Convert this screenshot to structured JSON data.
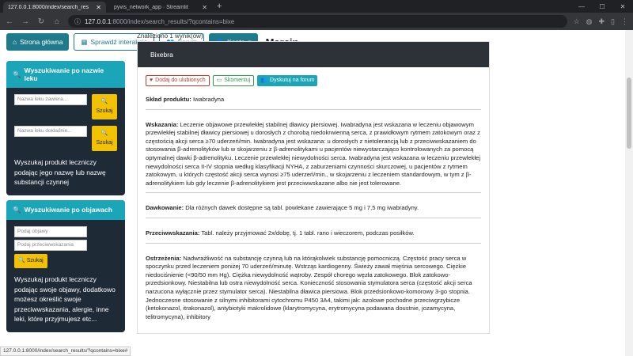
{
  "browser": {
    "tabs": [
      {
        "title": "127.0.0.1:8000/index/search_res",
        "active": true
      },
      {
        "title": "pyvis_network_app · Streamlit",
        "active": false
      }
    ],
    "address_host": "127.0.0.1",
    "address_path": ":8000/index/search_results/?qcontains=bixe",
    "status_url": "127.0.0.1:8000/index/search_results/?qcontains=bixe#"
  },
  "nav": {
    "home": "Strona główna",
    "check": "Sprawdź interakcje",
    "forum": "Forum",
    "account": "Konto",
    "user": "Marcin"
  },
  "sidebar": {
    "by_name": {
      "title": "Wyszukiwanie po nazwie leku",
      "input1_placeholder": "Nazwa leku zawiera...",
      "input2_placeholder": "Nazwa leku dokładnie...",
      "search_label": "Szukaj",
      "description": "Wyszukaj produkt leczniczy podając jego nazwę lub nazwę substancji czynnej"
    },
    "by_symptoms": {
      "title": "Wyszukiwanie po objawach",
      "input1_placeholder": "Podaj objawy",
      "input2_placeholder": "Podaj przeciwwskazania",
      "search_label": "Szukaj",
      "description": "Wyszukaj produkt leczniczy podając swoje objawy, dodatkowo możesz określić swoje przeciwwskazania, alergie, inne leki, które przyjmujesz etc..."
    }
  },
  "results": {
    "found_text": "Znaleziono 1 wynik(ów)",
    "product_name": "Bixebra",
    "actions": {
      "favorite": "Dodaj do ulubionych",
      "comment": "Skomentuj",
      "discuss": "Dyskutuj na forum"
    },
    "composition": {
      "label": "Skład produktu:",
      "text": "Iwabradyna"
    },
    "indications": {
      "label": "Wskazania:",
      "text": "Leczenie objawowe przewlekłej stabilnej dławicy piersiowej. Iwabradyna jest wskazana w leczeniu objawowym przewlekłej stabilnej dławicy piersiowej u dorosłych z chorobą niedokrwienną serca, z prawidłowym rytmem zatokowym oraz z częstością akcji serca ≥70 uderzeń/min. Iwabradyna jest wskazana: u dorosłych z nietolerancją lub z przeciwwskazaniem do stosowania β-adrenolityków lub w skojarzeniu z β-adrenolitykami u pacjentów niewystarczająco kontrolowanych za pomocą optymalnej dawki β-adrenolityku. Leczenie przewlekłej niewydolności serca. Iwabradyna jest wskazana w leczeniu przewlekłej niewydolności serca II-IV stopnia według klasyfikacji NYHA, z zaburzeniami czynności skurczowej, u pacjentów z rytmem zatokowym, u których częstość akcji serca wynosi ≥75 uderzeń/min., w skojarzeniu z leczeniem standardowym, w tym z β-adrenolitykiem lub gdy leczenie β-adrenolitykiem jest przeciwwskazane albo nie jest tolerowane."
    },
    "dosage": {
      "label": "Dawkowanie:",
      "text": "Dla różnych dawek dostępne są tabl. powlekane zawierające 5 mg i 7,5 mg iwabradyny."
    },
    "contraindications": {
      "label": "Przeciwwskazania:",
      "text": "Tabl. należy przyjmować 2x/dobę, tj. 1 tabl. rano i wieczorem, podczas posiłków."
    },
    "warnings": {
      "label": "Ostrzeżenia:",
      "text": "Nadwrażliwość na substancję czynną lub na którąkolwiek substancję pomocniczą. Częstość pracy serca w spoczynku przed leczeniem poniżej 70 uderzeń/minutę. Wstrząs kardiogenny. Świeży zawał mięśnia sercowego. Ciężkie niedociśnienie (<90/50 mm Hg). Ciężka niewydolność wątroby. Zespół chorego węzła zatokowego. Blok zatokowo-przedsionkowy. Niestabilna lub ostra niewydolność serca. Konieczność stosowania stymulatora serca (częstość akcji serca narzucona wyłącznie przez stymulator serca). Niestabilna dławica piersiowa. Blok przedsionkowo-komorowy 3-go stopnia. Jednoczesne stosowanie z silnymi inhibitorami cytochromu P450 3A4, takimi jak: azolowe pochodne przeciwgrzybicze (ketokonazol, itrakonazol), antybiotyki makrolidowe (klarytromycyna, erytromycyna podawana doustnie, jozamycyna, telitromycyna), inhibitory"
    }
  }
}
